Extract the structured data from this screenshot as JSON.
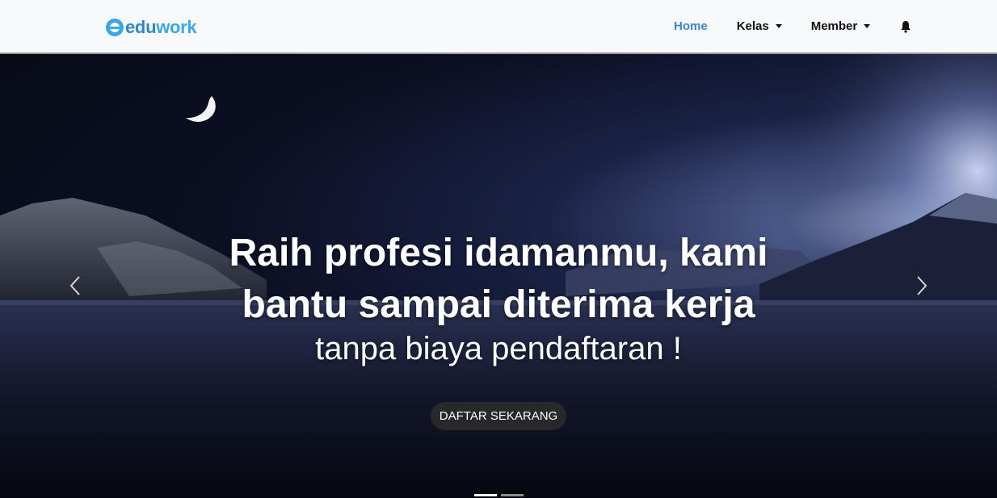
{
  "brand": {
    "part1": "edu",
    "part2": "work",
    "icon": "eduwork-logo-icon"
  },
  "nav": {
    "home": "Home",
    "kelas": "Kelas",
    "member": "Member",
    "bell_icon": "bell-icon"
  },
  "hero": {
    "headline_line1": "Raih profesi idamanmu, kami",
    "headline_line2": "bantu sampai diterima kerja",
    "subline": "tanpa biaya pendaftaran !",
    "cta": "DAFTAR SEKARANG",
    "prev_icon": "chevron-left-icon",
    "next_icon": "chevron-right-icon",
    "slides_count": 2,
    "active_slide": 1
  },
  "colors": {
    "brand_dark": "#2f86c9",
    "brand_light": "#3aa7e8",
    "nav_active": "#3a86c8"
  }
}
